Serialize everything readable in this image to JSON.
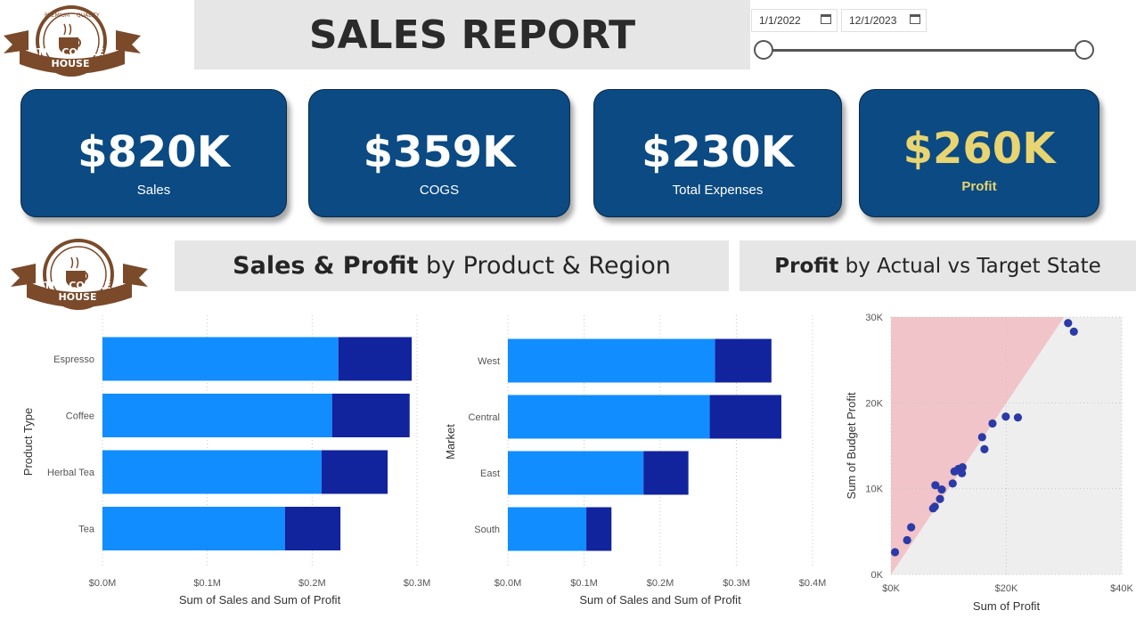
{
  "header": {
    "title": "SALES REPORT",
    "logo_text": "THE COFFEE HOUSE",
    "logo_arc_left": "PREMIUM",
    "logo_arc_right": "QUALITY"
  },
  "date_filter": {
    "start": "1/1/2022",
    "end": "12/1/2023",
    "range_fraction": [
      0,
      1
    ]
  },
  "kpis": [
    {
      "value": "$820K",
      "label": "Sales"
    },
    {
      "value": "$359K",
      "label": "COGS"
    },
    {
      "value": "$230K",
      "label": "Total Expenses"
    },
    {
      "value": "$260K",
      "label": "Profit"
    }
  ],
  "colors": {
    "kpi_bg": "#0b4a83",
    "profit_accent": "#e8d470",
    "sales_bar": "#118dff",
    "profit_bar": "#12239e",
    "scatter_dot": "#2b3aa6",
    "below_target": "#f0c4c8",
    "above_target": "#eeeeee"
  },
  "sections": {
    "left_bold": "Sales & Profit",
    "left_rest": " by Product & Region",
    "right_bold": "Profit",
    "right_rest": " by Actual vs Target State"
  },
  "chart_data": [
    {
      "type": "bar",
      "orientation": "horizontal",
      "stacked": true,
      "categories": [
        "Espresso",
        "Coffee",
        "Herbal Tea",
        "Tea"
      ],
      "series": [
        {
          "name": "Sum of Sales",
          "values": [
            225000,
            219000,
            209000,
            174000
          ]
        },
        {
          "name": "Sum of Profit",
          "values": [
            70000,
            74000,
            63000,
            53000
          ]
        }
      ],
      "ylabel": "Product Type",
      "xlabel": "Sum of Sales and Sum of Profit",
      "xlim": [
        0,
        300000
      ],
      "xticks": [
        "$0.0M",
        "$0.1M",
        "$0.2M",
        "$0.3M"
      ],
      "grid": true
    },
    {
      "type": "bar",
      "orientation": "horizontal",
      "stacked": true,
      "categories": [
        "West",
        "Central",
        "East",
        "South"
      ],
      "series": [
        {
          "name": "Sum of Sales",
          "values": [
            272000,
            265000,
            178000,
            103000
          ]
        },
        {
          "name": "Sum of Profit",
          "values": [
            74000,
            94000,
            59000,
            33000
          ]
        }
      ],
      "ylabel": "Market",
      "xlabel": "Sum of Sales and Sum of Profit",
      "xlim": [
        0,
        400000
      ],
      "xticks": [
        "$0.0M",
        "$0.1M",
        "$0.2M",
        "$0.3M",
        "$0.4M"
      ],
      "grid": true
    },
    {
      "type": "scatter",
      "x": [
        700,
        2800,
        3500,
        7300,
        7600,
        7700,
        8500,
        8800,
        10700,
        11000,
        11700,
        12300,
        12400,
        15800,
        16200,
        17600,
        19900,
        22000,
        30700,
        31700
      ],
      "y": [
        2600,
        4000,
        5500,
        7700,
        7900,
        10400,
        8800,
        9900,
        10600,
        12000,
        12300,
        11800,
        12500,
        16000,
        14600,
        17600,
        18400,
        18300,
        29300,
        28300
      ],
      "xlabel": "Sum of Profit",
      "ylabel": "Sum of Budget Profit",
      "xlim": [
        0,
        40000
      ],
      "ylim": [
        0,
        30000
      ],
      "xticks": [
        "$0K",
        "$20K",
        "$40K"
      ],
      "yticks": [
        "0K",
        "10K",
        "20K",
        "30K"
      ],
      "grid": true
    }
  ]
}
